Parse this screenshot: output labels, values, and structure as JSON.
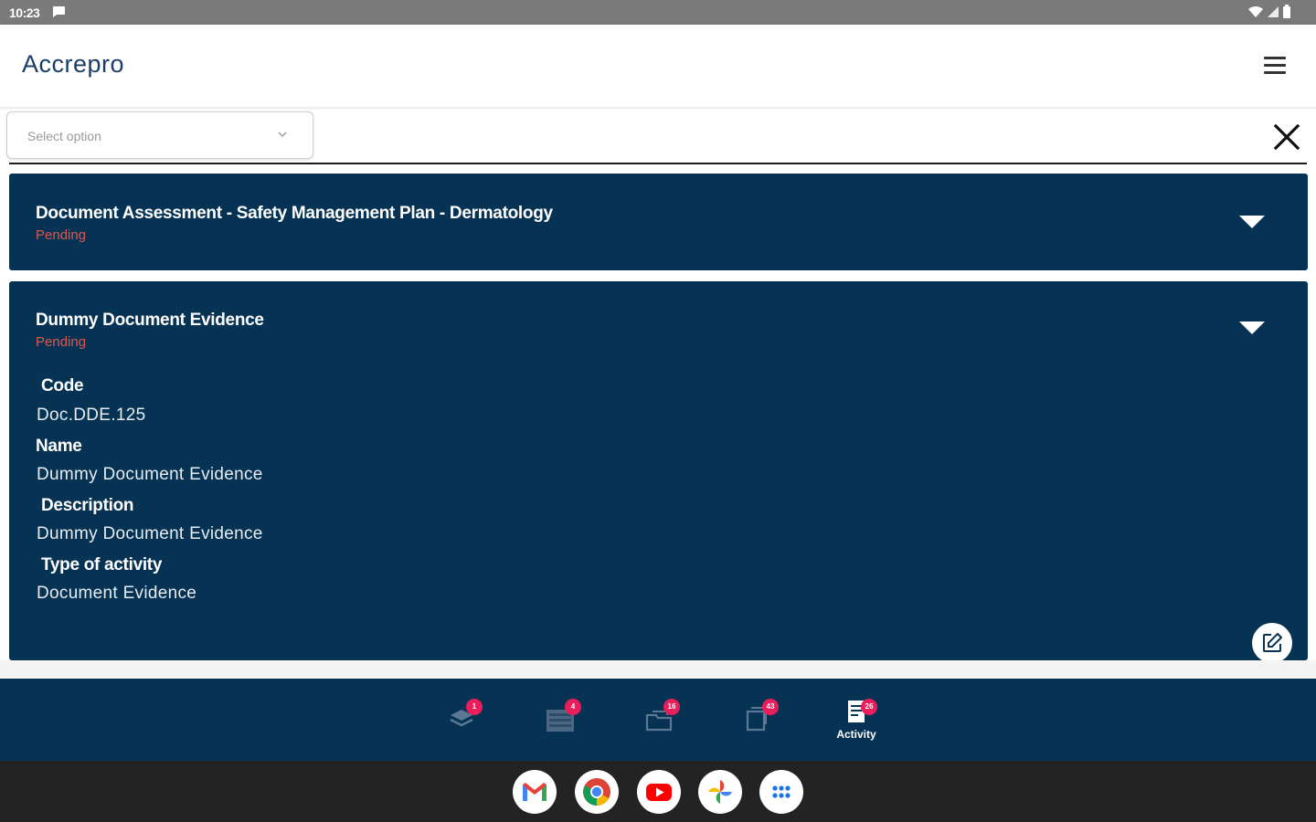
{
  "status_bar": {
    "time": "10:23"
  },
  "app": {
    "logo_text": "Accrepro"
  },
  "filter": {
    "placeholder": "Select option"
  },
  "cards": [
    {
      "title": "Document Assessment - Safety Management Plan - Dermatology",
      "status": "Pending"
    },
    {
      "title": "Dummy  Document  Evidence",
      "status": "Pending",
      "fields": [
        {
          "label": "Code",
          "value": "Doc.DDE.125"
        },
        {
          "label": "Name",
          "value": "Dummy  Document  Evidence"
        },
        {
          "label": "Description",
          "value": "Dummy  Document  Evidence"
        },
        {
          "label": "Type of activity",
          "value": "Document Evidence"
        }
      ]
    }
  ],
  "bottom_nav": {
    "items": [
      {
        "icon": "layers-icon",
        "badge": "1"
      },
      {
        "icon": "list-icon",
        "badge": "4"
      },
      {
        "icon": "folder-icon",
        "badge": "16"
      },
      {
        "icon": "document-icon",
        "badge": "43"
      },
      {
        "icon": "activity-icon",
        "badge": "26",
        "label": "Activity"
      }
    ]
  },
  "dock": {
    "apps": [
      "gmail",
      "chrome",
      "youtube",
      "photos",
      "app-launcher"
    ]
  },
  "colors": {
    "card_bg": "#063254",
    "status_pending": "#e2574c",
    "badge": "#e91e5a"
  }
}
